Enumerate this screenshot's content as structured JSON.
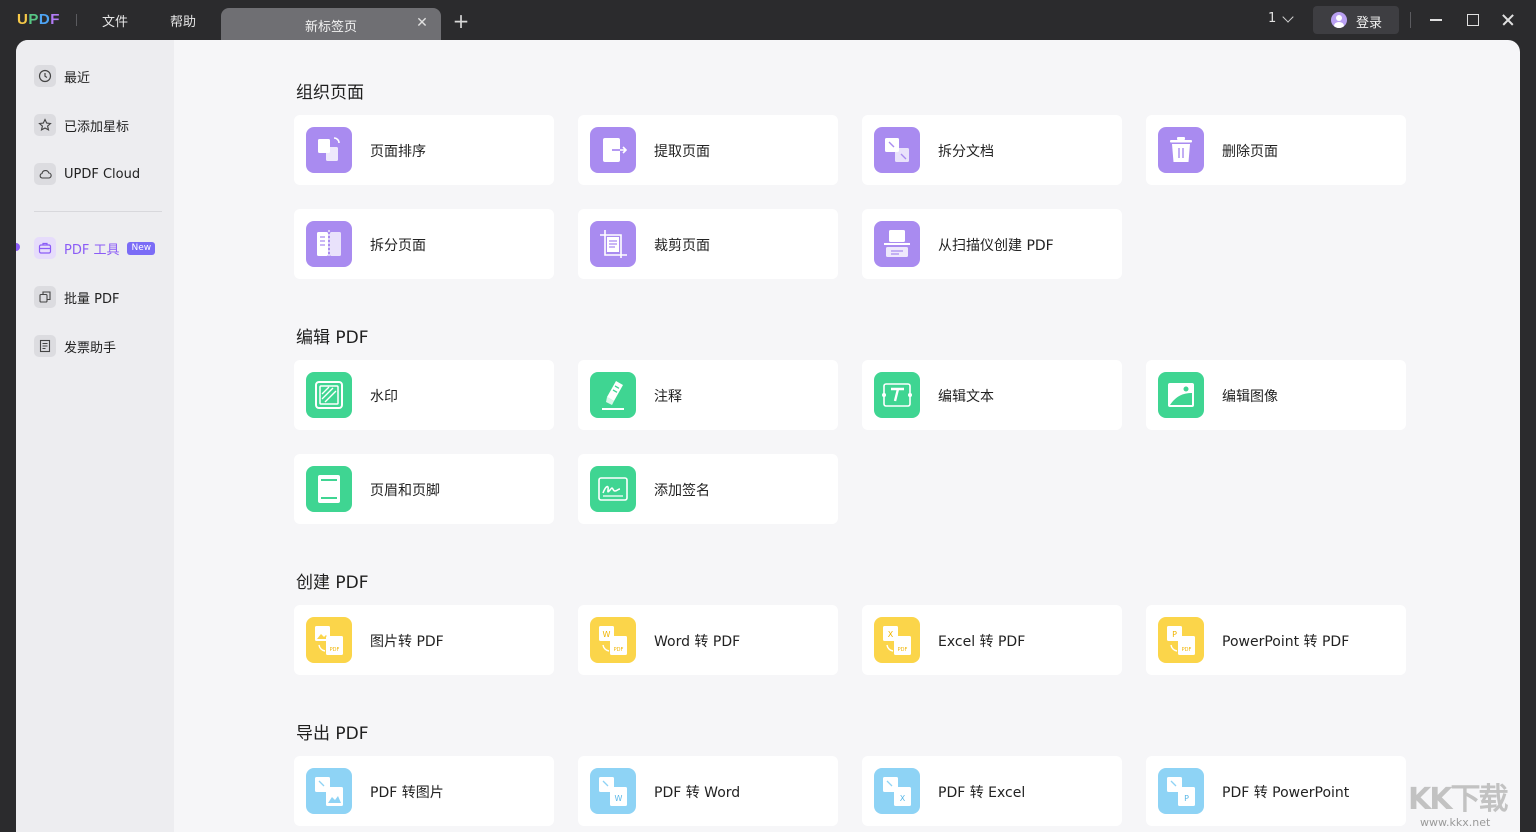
{
  "app": {
    "logo": {
      "u": "U",
      "p": "P",
      "d": "D",
      "f": "F"
    },
    "menu": [
      "文件",
      "帮助"
    ],
    "tab_title": "新标签页",
    "page_count": "1",
    "login_label": "登录"
  },
  "sidebar": {
    "items": [
      {
        "label": "最近",
        "icon": "clock-icon"
      },
      {
        "label": "已添加星标",
        "icon": "star-icon"
      },
      {
        "label": "UPDF Cloud",
        "icon": "cloud-icon"
      },
      {
        "label": "PDF 工具",
        "icon": "toolbox-icon",
        "badge": "New",
        "active": true
      },
      {
        "label": "批量 PDF",
        "icon": "batch-icon"
      },
      {
        "label": "发票助手",
        "icon": "invoice-icon"
      }
    ]
  },
  "sections": [
    {
      "title": "组织页面",
      "color": "#a98bf0",
      "cards": [
        {
          "label": "页面排序",
          "icon": "reorder-pages-icon"
        },
        {
          "label": "提取页面",
          "icon": "extract-pages-icon"
        },
        {
          "label": "拆分文档",
          "icon": "split-document-icon"
        },
        {
          "label": "删除页面",
          "icon": "delete-pages-icon"
        },
        {
          "label": "拆分页面",
          "icon": "split-pages-icon"
        },
        {
          "label": "裁剪页面",
          "icon": "crop-pages-icon"
        },
        {
          "label": "从扫描仪创建 PDF",
          "icon": "scanner-icon"
        }
      ]
    },
    {
      "title": "编辑 PDF",
      "color": "#3fd592",
      "cards": [
        {
          "label": "水印",
          "icon": "watermark-icon"
        },
        {
          "label": "注释",
          "icon": "annotate-icon"
        },
        {
          "label": "编辑文本",
          "icon": "edit-text-icon"
        },
        {
          "label": "编辑图像",
          "icon": "edit-image-icon"
        },
        {
          "label": "页眉和页脚",
          "icon": "header-footer-icon"
        },
        {
          "label": "添加签名",
          "icon": "signature-icon"
        }
      ]
    },
    {
      "title": "创建 PDF",
      "color": "#fbd54a",
      "cards": [
        {
          "label": "图片转 PDF",
          "icon": "image-to-pdf-icon"
        },
        {
          "label": "Word 转 PDF",
          "icon": "word-to-pdf-icon"
        },
        {
          "label": "Excel 转 PDF",
          "icon": "excel-to-pdf-icon"
        },
        {
          "label": "PowerPoint 转 PDF",
          "icon": "ppt-to-pdf-icon"
        }
      ]
    },
    {
      "title": "导出 PDF",
      "color": "#8ed3f5",
      "cards": [
        {
          "label": "PDF 转图片",
          "icon": "pdf-to-image-icon"
        },
        {
          "label": "PDF 转 Word",
          "icon": "pdf-to-word-icon"
        },
        {
          "label": "PDF 转 Excel",
          "icon": "pdf-to-excel-icon"
        },
        {
          "label": "PDF 转 PowerPoint",
          "icon": "pdf-to-ppt-icon"
        }
      ]
    }
  ],
  "icon_glyphs": {
    "create_pdf": "PDF",
    "word": "W",
    "excel": "X",
    "ppt": "P"
  },
  "watermark": {
    "big": "KK下载",
    "small": "www.kkx.net"
  }
}
